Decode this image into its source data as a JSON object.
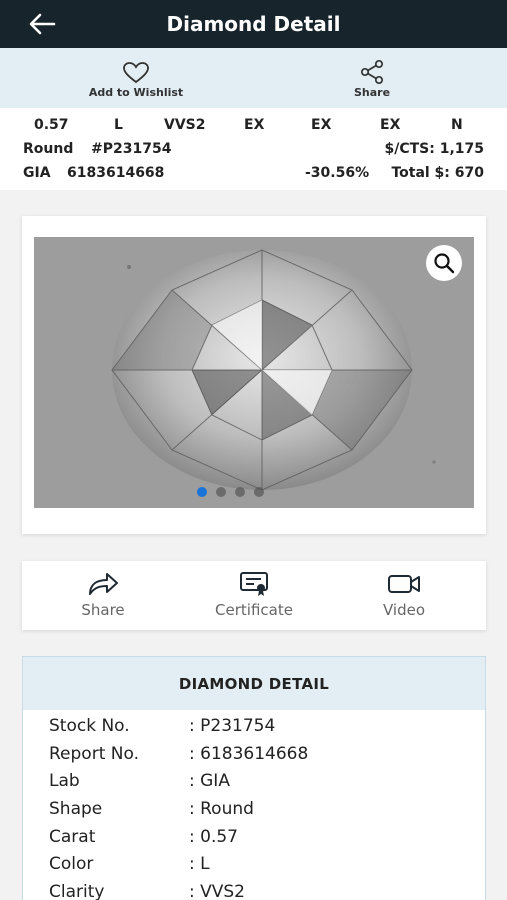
{
  "topbar": {
    "title": "Diamond Detail"
  },
  "actions": {
    "wishlist_label": "Add to Wishlist",
    "share_label": "Share"
  },
  "summary": {
    "carat": "0.57",
    "color": "L",
    "clarity": "VVS2",
    "cut": "EX",
    "polish": "EX",
    "symmetry": "EX",
    "fluorescence": "N",
    "shape": "Round",
    "stock": "#P231754",
    "price_per_carat": "$/CTS: 1,175",
    "lab": "GIA",
    "report": "6183614668",
    "discount": "-30.56%",
    "total": "Total $: 670"
  },
  "gallery": {
    "slides": 4,
    "active": 1
  },
  "media": {
    "share_label": "Share",
    "certificate_label": "Certificate",
    "video_label": "Video"
  },
  "detail": {
    "title": "DIAMOND DETAIL",
    "rows": [
      {
        "key": "Stock No.",
        "value": ": P231754"
      },
      {
        "key": "Report No.",
        "value": ": 6183614668"
      },
      {
        "key": "Lab",
        "value": ": GIA"
      },
      {
        "key": "Shape",
        "value": ": Round"
      },
      {
        "key": "Carat",
        "value": ": 0.57"
      },
      {
        "key": "Color",
        "value": ": L"
      },
      {
        "key": "Clarity",
        "value": ": VVS2"
      }
    ]
  },
  "colors": {
    "topbar": "#17242c",
    "action_bg": "#e3eef4",
    "dot_active": "#1a73d9"
  },
  "icons": {
    "back": "arrow-left-icon",
    "wishlist": "heart-icon",
    "share": "share-nodes-icon",
    "zoom": "search-icon",
    "share_media": "share-arrow-icon",
    "certificate": "certificate-icon",
    "video": "video-camera-icon"
  }
}
